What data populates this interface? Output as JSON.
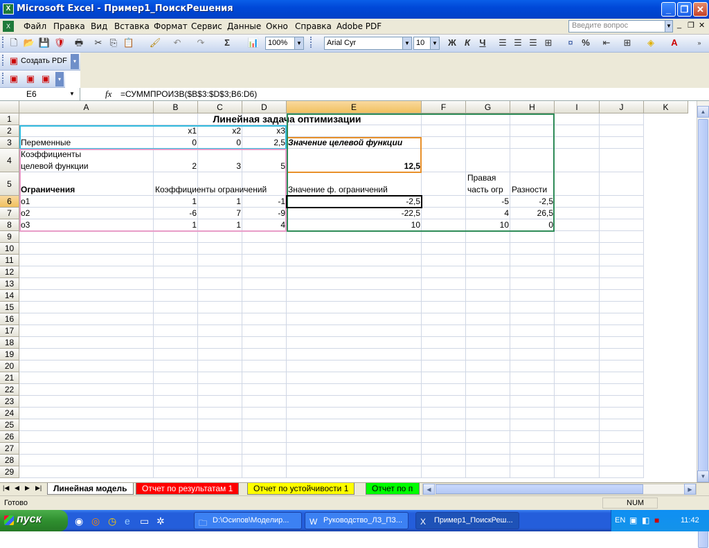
{
  "window": {
    "app_icon_text": "X",
    "title": "Microsoft Excel - Пример1_ПоискРешения",
    "minimize": "_",
    "restore": "❐",
    "close": "✕"
  },
  "menu": {
    "items": [
      "Файл",
      "Правка",
      "Вид",
      "Вставка",
      "Формат",
      "Сервис",
      "Данные",
      "Окно",
      "Справка",
      "Adobe PDF"
    ],
    "ask_placeholder": "Введите вопрос",
    "doc_min": "_",
    "doc_restore": "❐",
    "doc_close": "✕"
  },
  "toolbar": {
    "zoom": "100%",
    "font_name": "Arial Cyr",
    "font_size": "10",
    "bold": "Ж",
    "italic": "К",
    "underline": "Ч",
    "sigma": "Σ",
    "percent": "%",
    "font_color_letter": "A",
    "create_pdf": "Создать PDF"
  },
  "formula_bar": {
    "name_box": "E6",
    "fx": "fx",
    "formula": "=СУММПРОИЗВ($B$3:$D$3;B6:D6)"
  },
  "columns": [
    "A",
    "B",
    "C",
    "D",
    "E",
    "F",
    "G",
    "H",
    "I",
    "J",
    "K"
  ],
  "rows": [
    "1",
    "2",
    "3",
    "4",
    "5",
    "6",
    "7",
    "8",
    "9",
    "10",
    "11",
    "12",
    "13",
    "14",
    "15",
    "16",
    "17",
    "18",
    "19",
    "20",
    "21",
    "22",
    "23",
    "24",
    "25",
    "26",
    "27",
    "28",
    "29"
  ],
  "cells": {
    "A1": "Линейная задача оптимизации",
    "B2": "x1",
    "C2": "x2",
    "D2": "x3",
    "A3": "Переменные",
    "B3": "0",
    "C3": "0",
    "D3": "2,5",
    "E3": "Значение целевой функции",
    "A4a": "Коэффициенты",
    "A4b": "целевой функции",
    "B4": "2",
    "C4": "3",
    "D4": "5",
    "E4": "12,5",
    "A5": "Ограничения",
    "B5": "Коэффициенты ограничений",
    "E5": "Значение ф. ограничений",
    "G5a": "Правая",
    "G5b": "часть огр",
    "H5": "Разности",
    "A6": "о1",
    "B6": "1",
    "C6": "1",
    "D6": "-1",
    "E6": "-2,5",
    "G6": "-5",
    "H6": "-2,5",
    "A7": "о2",
    "B7": "-6",
    "C7": "7",
    "D7": "-9",
    "E7": "-22,5",
    "G7": "4",
    "H7": "26,5",
    "A8": "о3",
    "B8": "1",
    "C8": "1",
    "D8": "4",
    "E8": "10",
    "G8": "10",
    "H8": "0"
  },
  "sheets": [
    {
      "label": "Линейная модель",
      "color": "#ffffff"
    },
    {
      "label": "Отчет по результатам 1",
      "color": "#ff0000"
    },
    {
      "label": "Отчет по устойчивости 1",
      "color": "#ffff00"
    },
    {
      "label": "Отчет по п",
      "color": "#00ff00"
    }
  ],
  "status": {
    "ready": "Готово",
    "num": "NUM"
  },
  "taskbar": {
    "start": "пуск",
    "tasks": [
      "D:\\Осипов\\Моделир...",
      "Руководство_ЛЗ_ПЗ...",
      "Пример1_ПоискРеш..."
    ],
    "lang": "EN",
    "time": "11:42"
  }
}
